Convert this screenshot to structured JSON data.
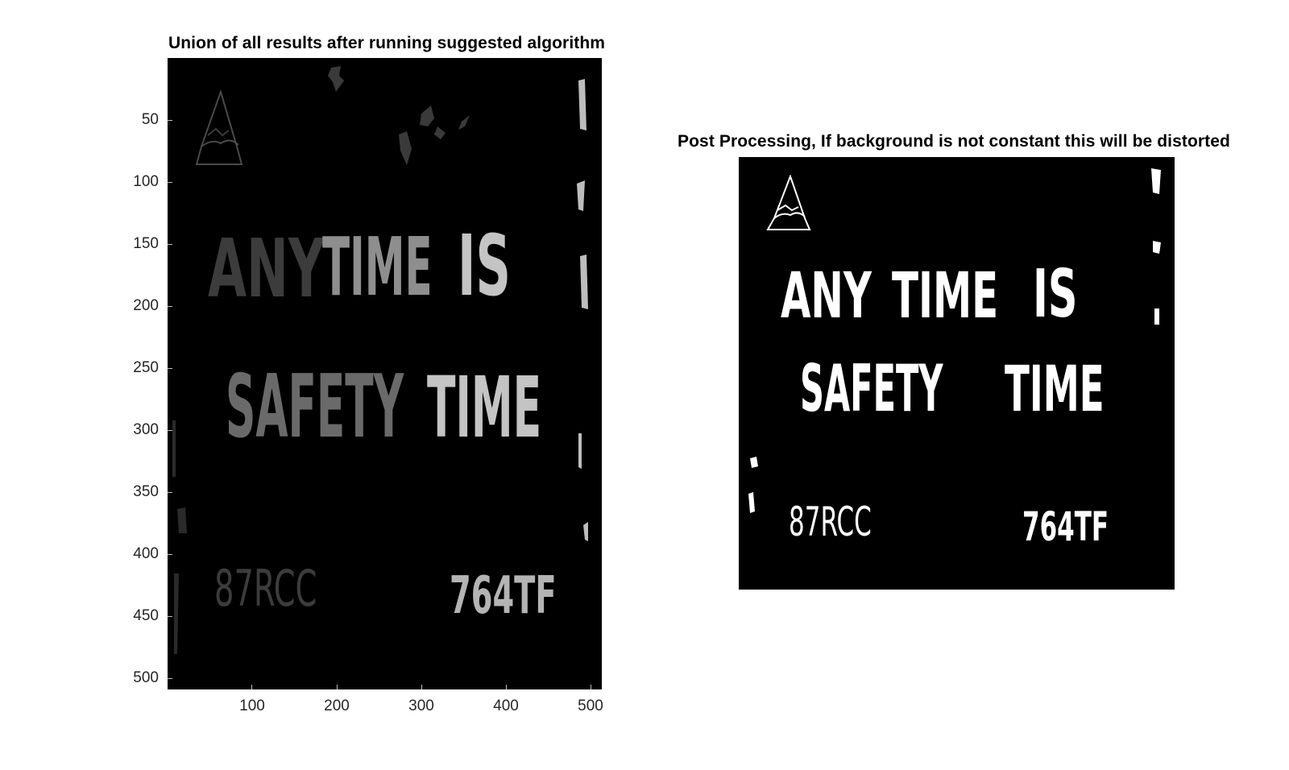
{
  "figure": {
    "left_title": "Union of all results after running suggested algorithm",
    "right_title": "Post Processing, If background is not constant this will be distorted"
  },
  "left_axes": {
    "y_ticks": [
      "50",
      "100",
      "150",
      "200",
      "250",
      "300",
      "350",
      "400",
      "450",
      "500"
    ],
    "x_ticks": [
      "100",
      "200",
      "300",
      "400",
      "500"
    ]
  },
  "image_content": {
    "line1_a": "ANY",
    "line1_b": "TIME",
    "line1_c": "IS",
    "line2_a": "SAFETY",
    "line2_b": "TIME",
    "code_left": "87RCC",
    "code_right": "764TF"
  },
  "colors": {
    "background": "#000000",
    "label_dark": "#3c3c3c",
    "label_mid": "#8e8e8e",
    "label_light": "#c4c4c4",
    "binary_white": "#ffffff"
  }
}
